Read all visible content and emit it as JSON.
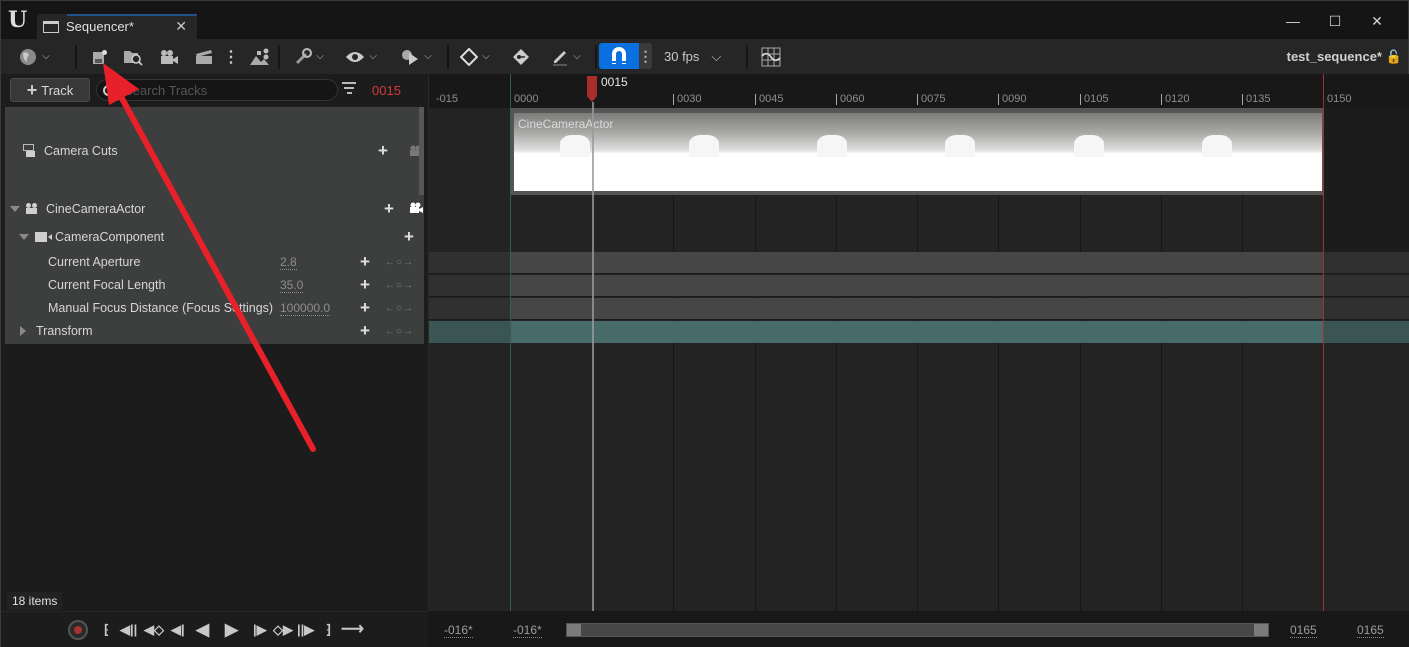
{
  "window": {
    "tab_title": "Sequencer*",
    "tab_close": "✕",
    "controls": {
      "minimize": "—",
      "maximize": "☐",
      "close": "✕"
    }
  },
  "toolbar": {
    "icons": [
      "world-icon",
      "save-icon",
      "browse-icon",
      "camera-icon",
      "clapboard-icon",
      "more-icon",
      "hierarchy-icon",
      "wrench-icon",
      "eye-icon",
      "playback-settings-icon",
      "key-diamond-icon",
      "key-icon",
      "edit-pen-icon",
      "snap-magnet-icon",
      "curve-editor-icon"
    ],
    "fps_label": "30 fps",
    "sequence_name": "test_sequence*",
    "lock_glyph": "🔓"
  },
  "left_panel": {
    "add_track_label": "Track",
    "search_placeholder": "Search Tracks",
    "current_frame": "0015",
    "items_count": "18 items",
    "tracks": [
      {
        "label": "Camera Cuts",
        "type": "camera-cuts"
      },
      {
        "label": "CineCameraActor",
        "type": "actor",
        "expanded": true
      },
      {
        "label": "CameraComponent",
        "type": "component",
        "expanded": true
      },
      {
        "label": "Current Aperture",
        "type": "property",
        "value": "2.8"
      },
      {
        "label": "Current Focal Length",
        "type": "property",
        "value": "35.0"
      },
      {
        "label": "Manual Focus Distance (Focus Settings)",
        "type": "property",
        "value": "100000.0"
      },
      {
        "label": "Transform",
        "type": "property-group",
        "expanded": false
      }
    ],
    "key_nav": "←○→"
  },
  "timeline": {
    "playhead_label": "0015",
    "ruler_ticks": [
      "-015",
      "0000",
      "0015",
      "0030",
      "0045",
      "0060",
      "0075",
      "0090",
      "0105",
      "0120",
      "0135",
      "0150"
    ],
    "shot_label": "CineCameraActor"
  },
  "range_bar": {
    "view_start": "-016*",
    "work_start": "-016*",
    "work_end": "0165",
    "view_end": "0165"
  },
  "transport": {
    "buttons": [
      {
        "name": "jump-to-start",
        "glyph": "⁅"
      },
      {
        "name": "step-back-key-large",
        "glyph": "◀||"
      },
      {
        "name": "prev-key",
        "glyph": "◀◇"
      },
      {
        "name": "step-back-frame",
        "glyph": "◀|"
      },
      {
        "name": "play-reverse",
        "glyph": "◀"
      },
      {
        "name": "play",
        "glyph": "▶"
      },
      {
        "name": "step-forward-frame",
        "glyph": "|▶"
      },
      {
        "name": "next-key",
        "glyph": "◇▶"
      },
      {
        "name": "step-forward-key-large",
        "glyph": "||▶"
      },
      {
        "name": "jump-to-end",
        "glyph": "⁆"
      },
      {
        "name": "loop-mode",
        "glyph": "⟶"
      }
    ]
  },
  "colors": {
    "accent_blue": "#0a70e0",
    "playhead_red": "#a82e2e",
    "frame_red": "#d23a3a",
    "transform_teal": "#466b68",
    "annotation_arrow": "#e8202a"
  }
}
